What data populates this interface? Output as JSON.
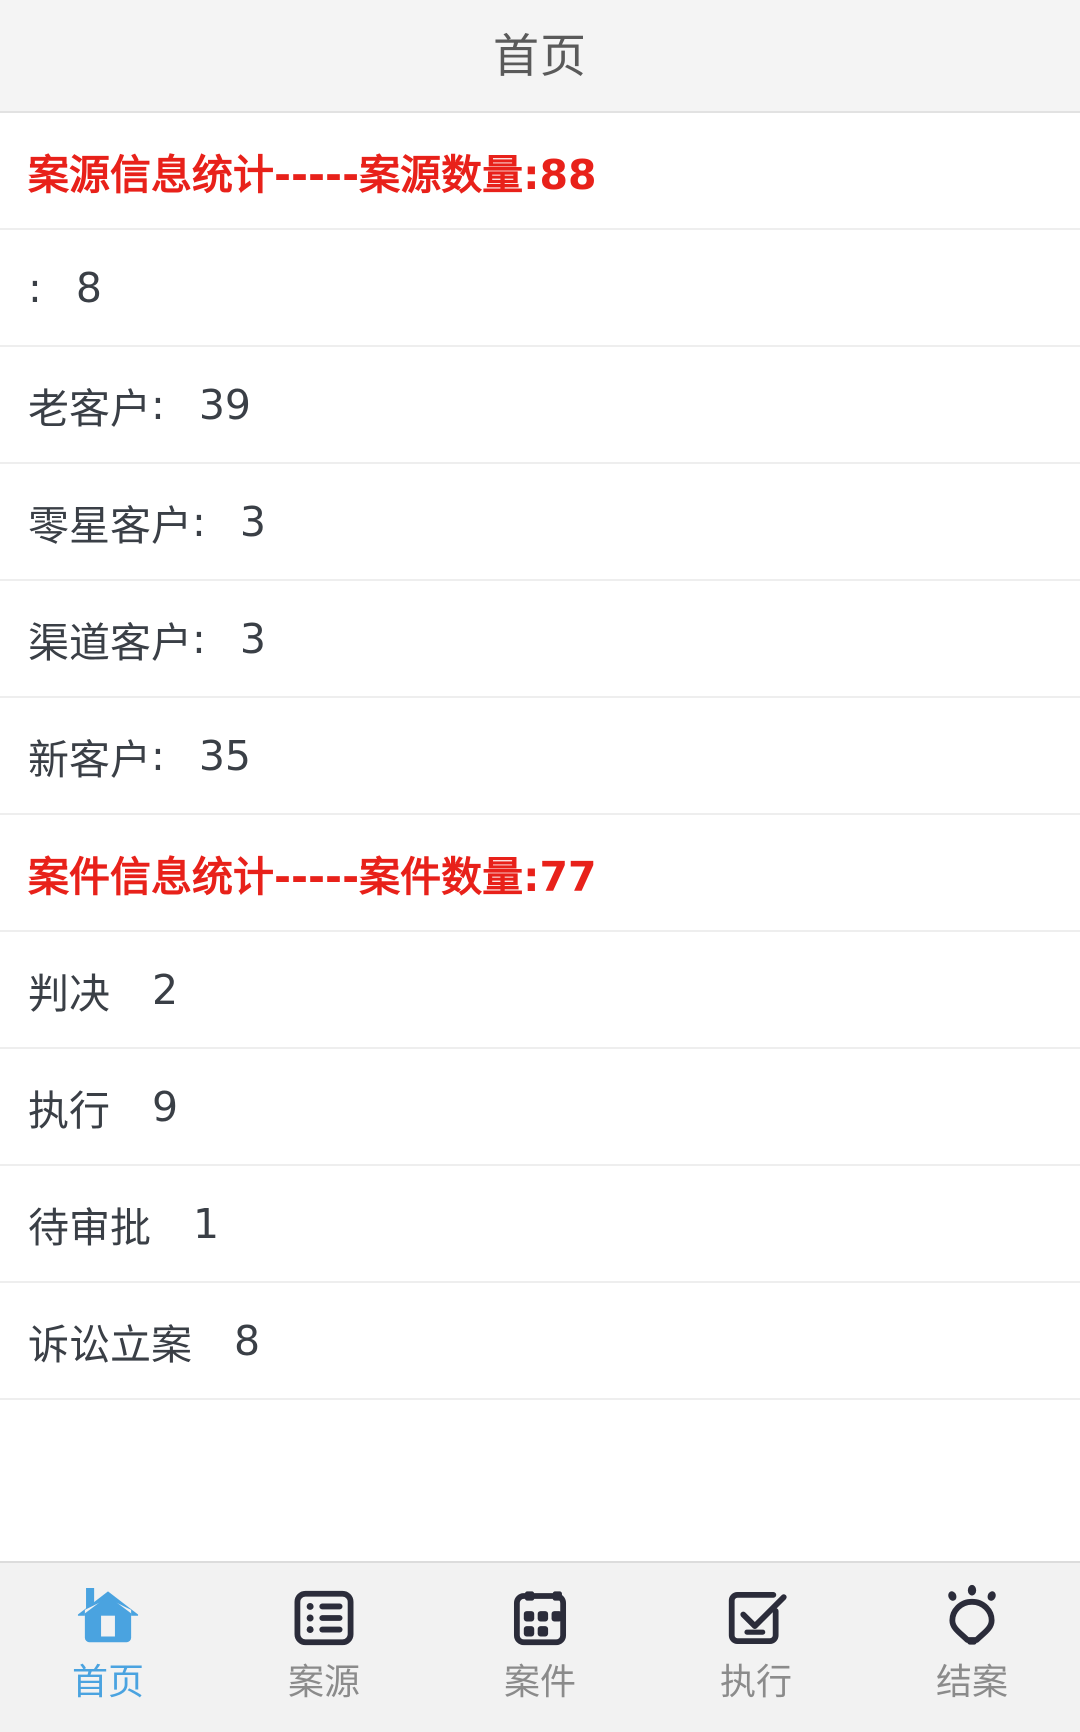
{
  "header": {
    "title": "首页"
  },
  "colors": {
    "section_red": "#e8211a",
    "text_dark": "#3a3f46",
    "active_blue": "#4aa3e0",
    "inactive_gray": "#8b8b8b",
    "titlebar_bg": "#f4f4f4",
    "tabbar_bg": "#f2f2f2",
    "divider": "#eeeeee"
  },
  "list": {
    "rows": [
      {
        "type": "section",
        "name": "case-source-statistics-header",
        "label": "案源信息统计-----案源数量:88",
        "metric_name": "案源数量",
        "metric_value": "88"
      },
      {
        "type": "item",
        "name": "row-blank-customer",
        "label": "",
        "separator": ":",
        "value": "8"
      },
      {
        "type": "item",
        "name": "row-old-customer",
        "label": "老客户",
        "separator": ":",
        "value": "39"
      },
      {
        "type": "item",
        "name": "row-sporadic-customer",
        "label": "零星客户",
        "separator": ":",
        "value": "3"
      },
      {
        "type": "item",
        "name": "row-channel-customer",
        "label": "渠道客户",
        "separator": ":",
        "value": "3"
      },
      {
        "type": "item",
        "name": "row-new-customer",
        "label": "新客户",
        "separator": ":",
        "value": "35"
      },
      {
        "type": "section",
        "name": "case-info-statistics-header",
        "label": "案件信息统计-----案件数量:77",
        "metric_name": "案件数量",
        "metric_value": "77"
      },
      {
        "type": "item",
        "name": "row-judgment",
        "label": "判决",
        "separator": "",
        "value": "2"
      },
      {
        "type": "item",
        "name": "row-execution",
        "label": "执行",
        "separator": "",
        "value": "9"
      },
      {
        "type": "item",
        "name": "row-pending-approval",
        "label": "待审批",
        "separator": "",
        "value": "1"
      },
      {
        "type": "item",
        "name": "row-litigation-filing",
        "label": "诉讼立案",
        "separator": "",
        "value": "8"
      }
    ]
  },
  "tabbar": {
    "items": [
      {
        "label": "首页",
        "icon": "home-icon",
        "active": true
      },
      {
        "label": "案源",
        "icon": "list-icon",
        "active": false
      },
      {
        "label": "案件",
        "icon": "calendar-icon",
        "active": false
      },
      {
        "label": "执行",
        "icon": "check-box-icon",
        "active": false
      },
      {
        "label": "结案",
        "icon": "lightbulb-icon",
        "active": false
      }
    ]
  }
}
